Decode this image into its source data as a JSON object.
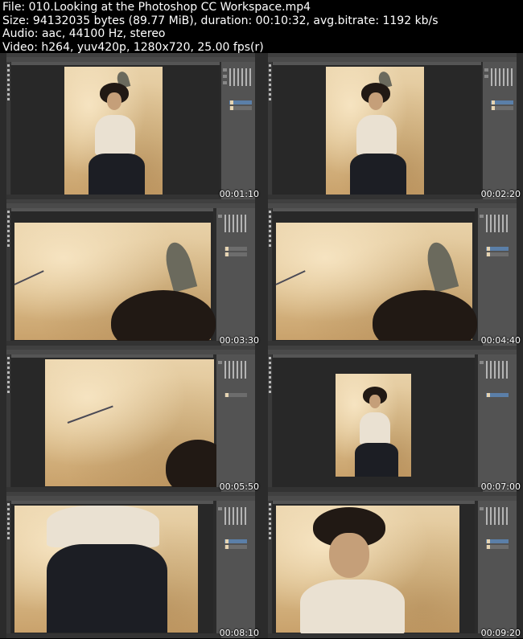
{
  "header": {
    "file": "File: 010.Looking at the Photoshop CC Workspace.mp4",
    "size": "Size: 94132035 bytes (89.77 MiB), duration: 00:10:32, avg.bitrate: 1192 kb/s",
    "audio": "Audio: aac, 44100 Hz, stereo",
    "video": "Video: h264, yuv420p, 1280x720, 25.00 fps(r)"
  },
  "thumbnails": [
    {
      "timestamp": "00:01:10"
    },
    {
      "timestamp": "00:02:20"
    },
    {
      "timestamp": "00:03:30"
    },
    {
      "timestamp": "00:04:40"
    },
    {
      "timestamp": "00:05:50"
    },
    {
      "timestamp": "00:07:00"
    },
    {
      "timestamp": "00:08:10"
    },
    {
      "timestamp": "00:09:20"
    }
  ],
  "colors": {
    "background": "#000000",
    "workspace": "#2b2b2b",
    "panel": "#535353",
    "paper": "#dbbd8b",
    "layer_selected": "#5b7fa8"
  },
  "icons": [
    "toolbar-tool-icon",
    "panel-icon",
    "layer-thumbnail-icon"
  ]
}
